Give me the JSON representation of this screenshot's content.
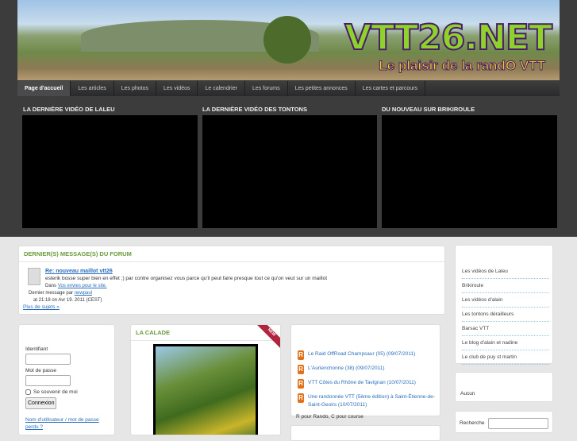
{
  "header": {
    "logo": "VTT26.NET",
    "slogan": "Le plaisir de la randO VTT"
  },
  "nav": [
    "Page d'accueil",
    "Les articles",
    "Les photos",
    "Les vidéos",
    "Le calendrier",
    "Les forums",
    "Les petites annonces",
    "Les cartes et parcours"
  ],
  "videos": [
    {
      "title": "LA DERNIÈRE VIDÉO DE LALEU"
    },
    {
      "title": "LA DERNIÈRE VIDÉO DES TONTONS"
    },
    {
      "title": "DU NOUVEAU SUR BRIKIROULE"
    }
  ],
  "forum": {
    "title": "DERNIER(S) MESSAGE(S) DU FORUM",
    "post_title": "Re: nouveau maillot vtt26",
    "excerpt": "esterik bosse super bien en effet ;) par contre organisez vous parce qu'il peut faire presque tout ce qu'on veut sur un maillot",
    "in_label": "Dans",
    "in_link": "Vos envies pour le site.",
    "last_by": "Dernier message par",
    "author": "newpaul",
    "date": "at 21:18 on Avr 19. 2011 (CEST)",
    "more": "Plus de sujets »"
  },
  "login": {
    "identifiant": "Identifiant",
    "password": "Mot de passe",
    "remember": "Se souvenir de moi",
    "submit": "Connexion",
    "lost": "Nom d'utilisateur / mot de passe perdu ?"
  },
  "calade": {
    "title": "LA CALADE",
    "badge": "NEW"
  },
  "events": {
    "items": [
      "Le Raid OffRoad Champsaur (05) (09/07/2011)",
      "L'Aurienchonne (38) (09/07/2011)",
      "VTT Côtes du Rhône de Tavignan (10/07/2011)",
      "Une randonnée VTT (5ème édition) à Saint-Étienne-de-Saint-Geoirs (10/07/2011)"
    ],
    "icon_letter": "R",
    "note": "R pour Rando, C pour course"
  },
  "links": [
    "Les vidéos de Laleu",
    "Brikiroule",
    "Les vidéos d'alain",
    "Les tontons dérailleurs",
    "Barsac VTT",
    "Le blog d'alain et nadine",
    "Le club de puy st martin"
  ],
  "aucun": "Aucun",
  "search": {
    "label": "Recherche",
    "value": ""
  }
}
